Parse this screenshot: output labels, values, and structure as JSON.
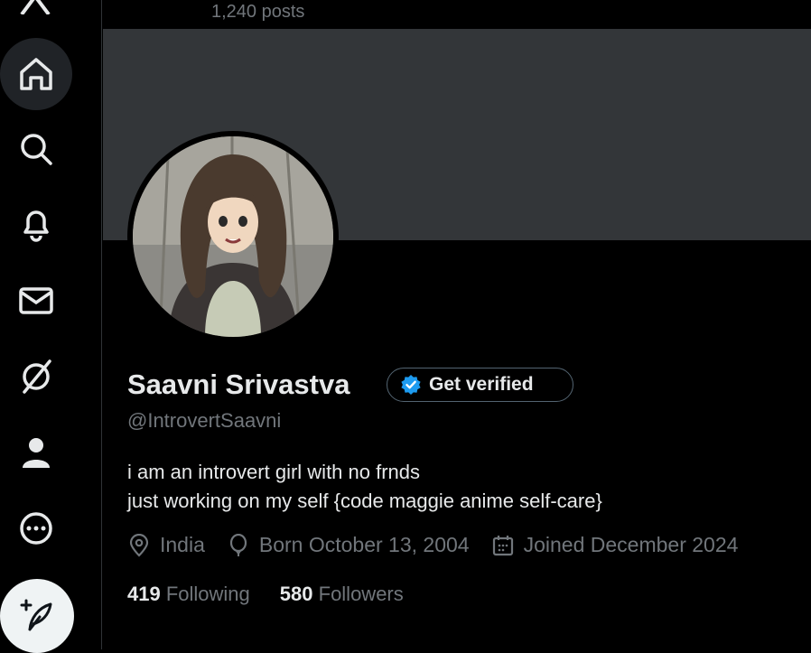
{
  "header": {
    "posts_count": "1,240 posts"
  },
  "sidebar": {
    "items": [
      {
        "icon": "x-logo-icon"
      },
      {
        "icon": "home-icon"
      },
      {
        "icon": "search-icon"
      },
      {
        "icon": "notifications-bell-icon"
      },
      {
        "icon": "messages-envelope-icon"
      },
      {
        "icon": "grok-slash-icon"
      },
      {
        "icon": "profile-person-icon"
      },
      {
        "icon": "more-dots-icon"
      }
    ],
    "compose_icon": "compose-feather-icon"
  },
  "profile": {
    "name": "Saavni Srivastva",
    "verify_label": "Get verified",
    "handle": "@IntrovertSaavni",
    "bio_line1": "i am an introvert girl with no frnds",
    "bio_line2": "just working on my self {code maggie anime self-care}",
    "location": "India",
    "birthday": "Born October 13, 2004",
    "joined": "Joined December 2024",
    "following_count": "419",
    "following_label": "Following",
    "followers_count": "580",
    "followers_label": "Followers"
  },
  "colors": {
    "background": "#000000",
    "banner": "#333639",
    "text_primary": "#e7e9ea",
    "text_secondary": "#71767b",
    "verified_blue": "#1d9bf0"
  }
}
